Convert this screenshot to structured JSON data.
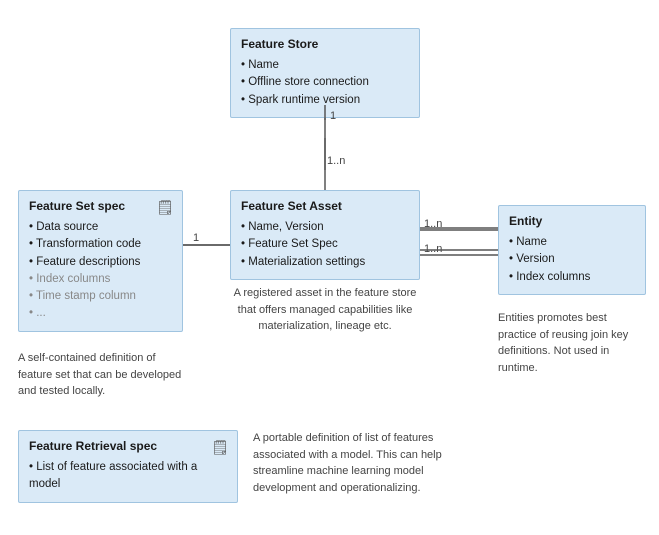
{
  "boxes": {
    "feature_store": {
      "title": "Feature Store",
      "items": [
        "Name",
        "Offline store connection",
        "Spark runtime version"
      ],
      "gray_items": []
    },
    "feature_set_spec": {
      "title": "Feature Set spec",
      "items": [
        "Data source",
        "Transformation code",
        "Feature descriptions"
      ],
      "gray_items": [
        "Index columns",
        "Time stamp column",
        "..."
      ],
      "description": "A self-contained definition of feature set that can be developed and tested locally."
    },
    "feature_set_asset": {
      "title": "Feature Set Asset",
      "items": [
        "Name, Version",
        "Feature Set Spec",
        "Materialization settings"
      ],
      "gray_items": [],
      "description": "A registered asset in the feature store that offers managed capabilities like materialization, lineage etc."
    },
    "entity": {
      "title": "Entity",
      "items": [
        "Name",
        "Version",
        "Index columns"
      ],
      "gray_items": [],
      "description": "Entities promotes best practice of reusing join key definitions. Not used in runtime."
    },
    "feature_retrieval_spec": {
      "title": "Feature Retrieval spec",
      "items": [
        "List of feature associated with a model"
      ],
      "gray_items": [],
      "description": "A portable definition of list of features associated with a model. This can help streamline machine learning model development and operationalizing."
    }
  },
  "labels": {
    "one_top": "1",
    "one_n_top": "1..n",
    "one_left": "1",
    "one_n_right1": "1..n",
    "one_n_right2": "1..n"
  }
}
